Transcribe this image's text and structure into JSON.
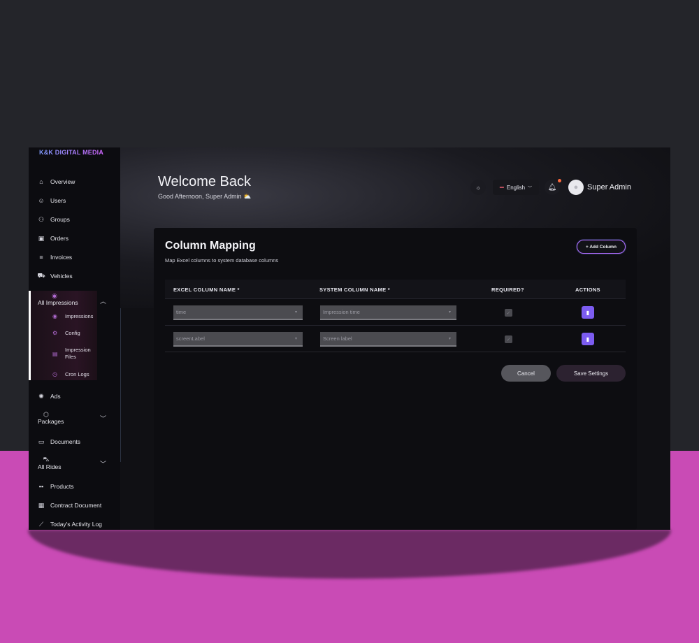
{
  "brand": "K&K DIGITAL MEDIA",
  "sidebar": {
    "items": [
      {
        "label": "Overview",
        "icon": "home-icon"
      },
      {
        "label": "Users",
        "icon": "user-icon"
      },
      {
        "label": "Groups",
        "icon": "users-icon"
      },
      {
        "label": "Orders",
        "icon": "clipboard-icon"
      },
      {
        "label": "Invoices",
        "icon": "invoice-icon"
      },
      {
        "label": "Vehicles",
        "icon": "car-icon"
      },
      {
        "label": "All Impressions",
        "icon": "eye-icon"
      },
      {
        "label": "Ads",
        "icon": "ads-icon"
      },
      {
        "label": "Packages",
        "icon": "box-icon"
      },
      {
        "label": "Documents",
        "icon": "document-icon"
      },
      {
        "label": "All Rides",
        "icon": "car-front-icon"
      },
      {
        "label": "Products",
        "icon": "grid-icon"
      },
      {
        "label": "Contract Document",
        "icon": "contract-icon"
      },
      {
        "label": "Today's Activity Log",
        "icon": "chart-icon"
      }
    ],
    "sub_items": [
      {
        "label": "Impressions",
        "icon": "eye-icon"
      },
      {
        "label": "Config",
        "icon": "gear-icon"
      },
      {
        "label": "Impression Files",
        "icon": "file-icon"
      },
      {
        "label": "Cron Logs",
        "icon": "clock-icon"
      }
    ]
  },
  "header": {
    "title": "Welcome Back",
    "greeting": "Good Afternoon, Super Admin ⛅",
    "language": "English",
    "user_name": "Super Admin"
  },
  "card": {
    "title": "Column Mapping",
    "subtitle": "Map Excel columns to system database columns",
    "add_button": "+ Add Column",
    "columns": [
      "EXCEL COLUMN NAME *",
      "SYSTEM COLUMN NAME *",
      "REQUIRED?",
      "ACTIONS"
    ],
    "rows": [
      {
        "excel": "time",
        "system": "Impression time"
      },
      {
        "excel": "screenLabel",
        "system": "Screen label"
      }
    ],
    "cancel_label": "Cancel",
    "save_label": "Save Settings"
  },
  "colors": {
    "accent": "#7c5cf0",
    "page_background_top": "#24252a",
    "page_background_bottom": "#c94bb5",
    "notification": "#ff6a3d"
  }
}
